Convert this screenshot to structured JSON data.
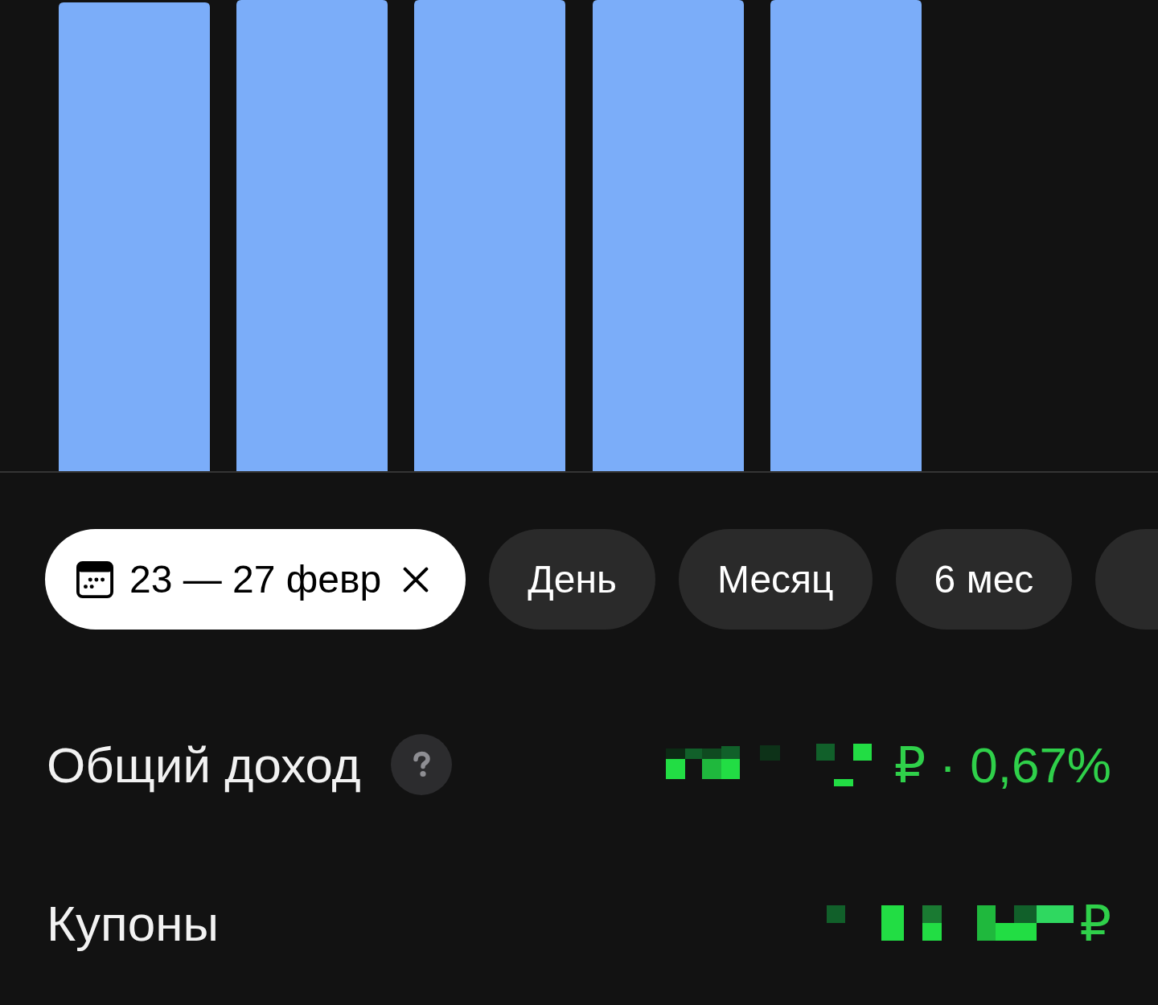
{
  "chips": [
    {
      "kind": "date_range",
      "label": "23 — 27 февр",
      "selected": true
    },
    {
      "kind": "period",
      "label": "День",
      "selected": false
    },
    {
      "kind": "period",
      "label": "Месяц",
      "selected": false
    },
    {
      "kind": "period",
      "label": "6 мес",
      "selected": false
    },
    {
      "kind": "period",
      "selected": false
    }
  ],
  "metrics": [
    {
      "label": "Общий доход",
      "help": true,
      "redacted": true,
      "value": "₽ · 0,67%"
    },
    {
      "label": "Купоны",
      "help": false,
      "redacted": true,
      "value": "₽"
    }
  ]
}
